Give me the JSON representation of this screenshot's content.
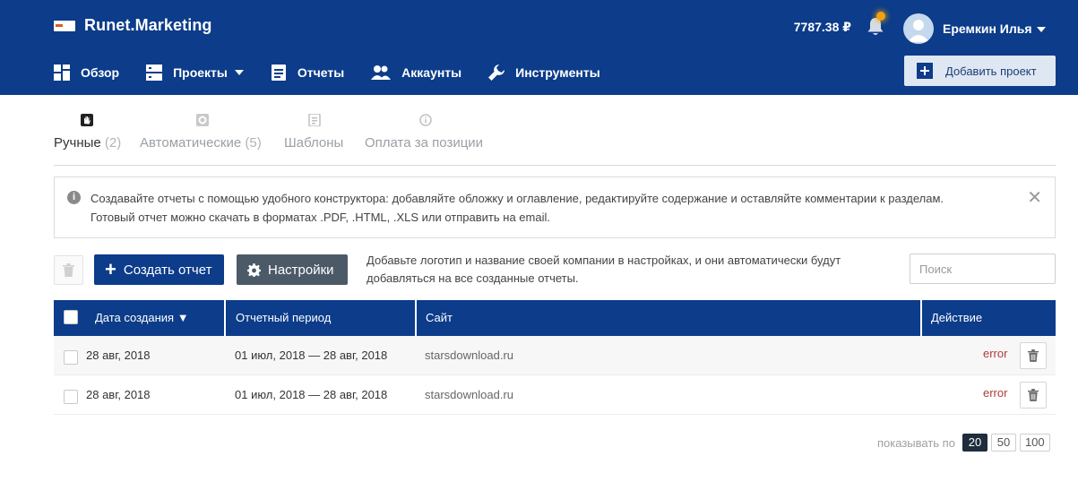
{
  "header": {
    "logo_text": "Runet.Marketing",
    "balance": "7787.38 ₽",
    "user_name": "Еремкин Илья",
    "add_project_label": "Добавить проект"
  },
  "nav": {
    "items": [
      {
        "label": "Обзор",
        "icon": "dashboard-icon"
      },
      {
        "label": "Проекты",
        "icon": "projects-icon",
        "has_dropdown": true
      },
      {
        "label": "Отчеты",
        "icon": "reports-icon"
      },
      {
        "label": "Аккаунты",
        "icon": "users-icon"
      },
      {
        "label": "Инструменты",
        "icon": "wrench-icon"
      }
    ]
  },
  "tabs": [
    {
      "label": "Ручные",
      "count": "(2)",
      "icon": "hand-icon",
      "active": true
    },
    {
      "label": "Автоматические",
      "count": "(5)",
      "icon": "gear-icon",
      "active": false
    },
    {
      "label": "Шаблоны",
      "count": "",
      "icon": "template-icon",
      "active": false
    },
    {
      "label": "Оплата за позиции",
      "count": "",
      "icon": "info-icon",
      "active": false
    }
  ],
  "info": {
    "line1": "Создавайте отчеты с помощью удобного конструктора: добавляйте обложку и оглавление, редактируйте содержание и оставляйте комментарии к разделам.",
    "line2": "Готовый отчет можно скачать в форматах .PDF, .HTML, .XLS или отправить на email.",
    "close": "✕"
  },
  "toolbar": {
    "create_label": "Создать отчет",
    "settings_label": "Настройки",
    "hint_line1": "Добавьте логотип и название своей компании в настройках, и они автоматически будут",
    "hint_line2": "добавляться на все созданные отчеты.",
    "search_placeholder": "Поиск"
  },
  "table": {
    "columns": [
      "Дата создания ▼",
      "Отчетный период",
      "Сайт",
      "Действие"
    ],
    "rows": [
      {
        "date": "28 авг, 2018",
        "period": "01 июл, 2018 — 28 авг, 2018",
        "site": "starsdownload.ru",
        "status": "error"
      },
      {
        "date": "28 авг, 2018",
        "period": "01 июл, 2018 — 28 авг, 2018",
        "site": "starsdownload.ru",
        "status": "error"
      }
    ]
  },
  "pager": {
    "label": "показывать по",
    "sizes": [
      "20",
      "50",
      "100"
    ],
    "active": "20"
  },
  "colors": {
    "brand": "#0c3c8a",
    "settings": "#4c5a68",
    "error": "#b23b3b",
    "notification": "#f0a20a"
  }
}
